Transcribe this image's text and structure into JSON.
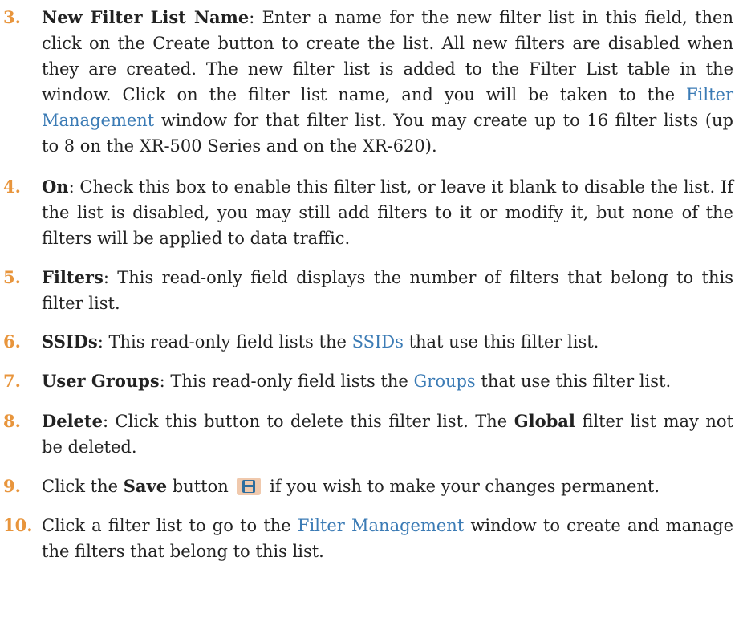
{
  "items": [
    {
      "num": "3.",
      "label": "New Filter List Name",
      "text_a": ": Enter a name for the new filter list in this field, then click on the Create button to create the list. All new filters are disabled when they are created. The new filter list is added to the Filter List table in the window. Click on the filter list name, and you will be taken to the ",
      "link": "Filter Management",
      "text_b": " window for that filter list. You may create up to 16 filter lists (up to 8 on the XR-500 Series and on the XR-620)."
    },
    {
      "num": "4.",
      "label": "On",
      "text_a": ": Check this box to enable this filter list, or leave it blank to disable the list. If the list is disabled, you may still add filters to it or modify it, but none of the filters will be applied to data traffic."
    },
    {
      "num": "5.",
      "label": "Filters",
      "text_a": ": This read-only field displays the number of filters that belong to this filter list."
    },
    {
      "num": "6.",
      "label": "SSIDs",
      "text_a": ": This read-only field lists the ",
      "link": "SSIDs",
      "text_b": " that use this filter list."
    },
    {
      "num": "7.",
      "label": "User Groups",
      "text_a": ": This read-only field lists the ",
      "link": "Groups",
      "text_b": " that use this filter list."
    },
    {
      "num": "8.",
      "label": "Delete",
      "text_a": ": Click this button to delete this filter list. The ",
      "label2": "Global",
      "text_b": " filter list may not be deleted."
    },
    {
      "num": "9.",
      "text_a": "Click the ",
      "label": "Save",
      "text_b": " button ",
      "icon": "save-icon",
      "text_c": " if you wish to make your changes permanent."
    },
    {
      "num": "10.",
      "text_a": "Click a filter list to go to the ",
      "link": "Filter Management",
      "text_b": " window to create and manage the filters that belong to this list."
    }
  ],
  "colors": {
    "number": "#e8953c",
    "link": "#3b7bb5",
    "text": "#222222",
    "save_icon_bg": "#f0c9ad",
    "save_icon_fg": "#2f6e9e"
  }
}
